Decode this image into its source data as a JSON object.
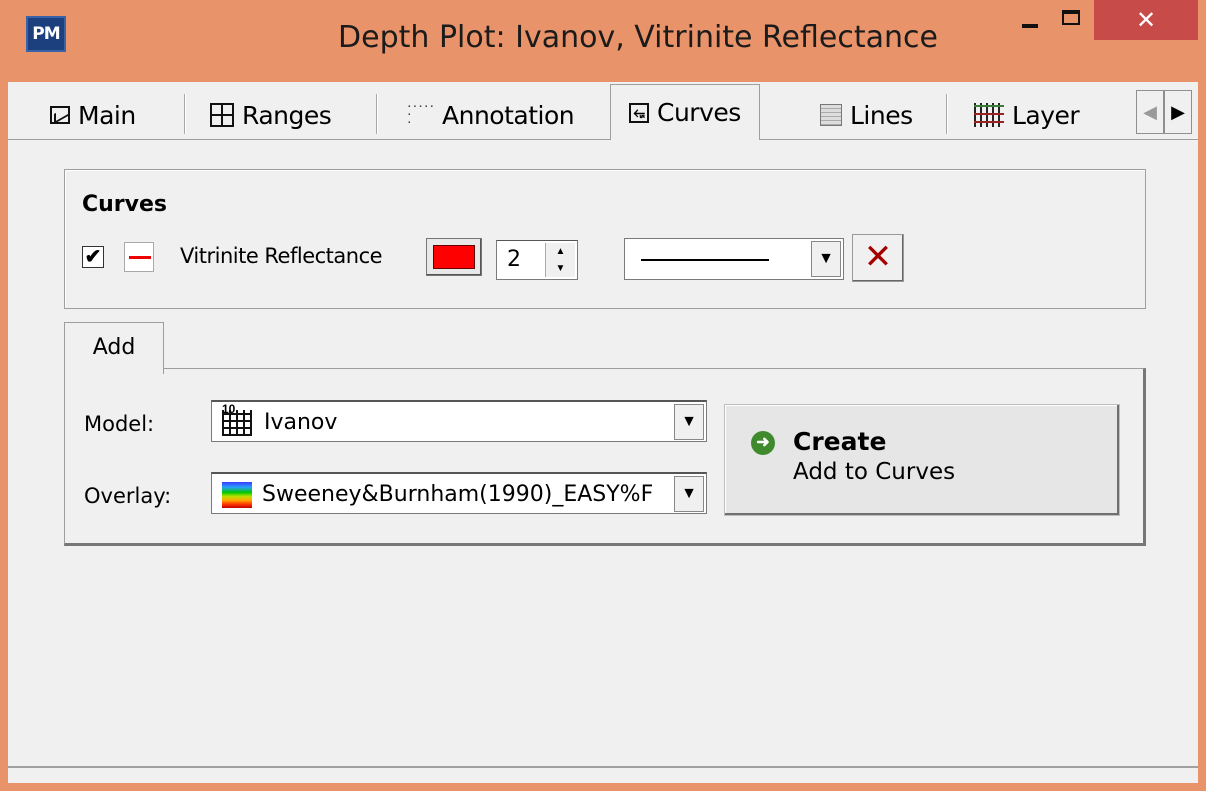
{
  "window": {
    "app_icon_text": "PM",
    "title": "Depth Plot: Ivanov,  Vitrinite Reflectance",
    "close_glyph": "✕"
  },
  "tabs": [
    {
      "label": "Main",
      "icon": "chart-icon"
    },
    {
      "label": "Ranges",
      "icon": "ranges-icon"
    },
    {
      "label": "Annotation",
      "icon": "annotation-icon"
    },
    {
      "label": "Curves",
      "icon": "curves-icon",
      "active": true
    },
    {
      "label": "Lines",
      "icon": "lines-icon"
    },
    {
      "label": "Layer",
      "icon": "layer-icon"
    }
  ],
  "curves_group": {
    "title": "Curves",
    "curve": {
      "checked": true,
      "check_glyph": "✔",
      "name": "Vitrinite Reflectance",
      "color": "#ff0000",
      "width": "2",
      "line_style": "solid",
      "delete_glyph": "✕"
    }
  },
  "add_panel": {
    "tab_label": "Add",
    "model_label": "Model:",
    "model_value": "Ivanov",
    "overlay_label": "Overlay:",
    "overlay_value": "Sweeney&Burnham(1990)_EASY%F",
    "create_title": "Create",
    "create_subtitle": "Add to Curves"
  }
}
